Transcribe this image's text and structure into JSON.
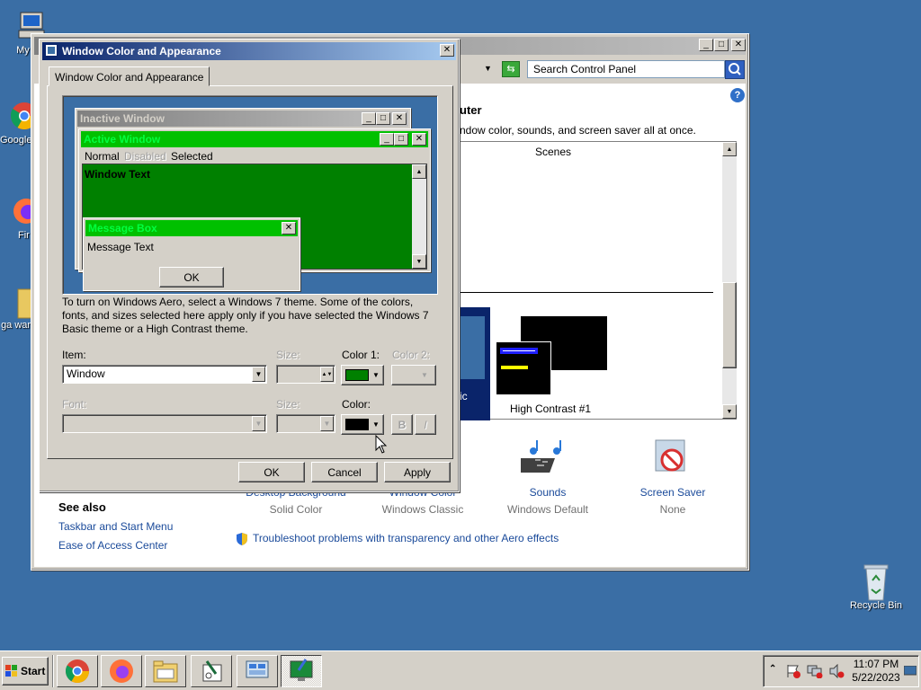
{
  "desktop": {
    "icons": [
      {
        "label": "My Co"
      },
      {
        "label": "Google"
      },
      {
        "label": "Fir"
      },
      {
        "label": "ga warfar"
      },
      {
        "label": "Recycle Bin"
      }
    ]
  },
  "control_panel": {
    "search_placeholder": "Search Control Panel",
    "heading_fragment": "uter",
    "desc_fragment": "ndow color, sounds, and screen saver all at once.",
    "scenes_label": "Scenes",
    "theme_basic_fragment": "ic",
    "theme_hc_label": "High Contrast #1",
    "items": [
      {
        "title": "Desktop Background",
        "value": "Solid Color"
      },
      {
        "title": "Window Color",
        "value": "Windows Classic"
      },
      {
        "title": "Sounds",
        "value": "Windows Default"
      },
      {
        "title": "Screen Saver",
        "value": "None"
      }
    ],
    "see_also": {
      "title": "See also",
      "links": [
        "Taskbar and Start Menu",
        "Ease of Access Center"
      ]
    },
    "troubleshoot": "Troubleshoot problems with transparency and other Aero effects"
  },
  "dialog": {
    "title": "Window Color and Appearance",
    "tab_label": "Window Color and Appearance",
    "preview": {
      "inactive_title": "Inactive Window",
      "active_title": "Active Window",
      "menu_normal": "Normal",
      "menu_disabled": "Disabled",
      "menu_selected": "Selected",
      "window_text": "Window Text",
      "msgbox_title": "Message Box",
      "msgbox_text": "Message Text",
      "msgbox_ok": "OK"
    },
    "info_text": "To turn on Windows Aero, select a Windows 7 theme.  Some of the colors, fonts, and sizes selected here apply only if you have selected the Windows 7 Basic theme or a High Contrast theme.",
    "item_label": "Item:",
    "item_value": "Window",
    "size_label": "Size:",
    "color1_label": "Color 1:",
    "color2_label": "Color 2:",
    "font_label": "Font:",
    "font_size_label": "Size:",
    "color_label": "Color:",
    "bold_label": "B",
    "italic_label": "I",
    "buttons": {
      "ok": "OK",
      "cancel": "Cancel",
      "apply": "Apply"
    },
    "colors": {
      "color1": "#008000",
      "font_color": "#000000",
      "preview_bg": "#008000",
      "active_title": "#00c000"
    }
  },
  "taskbar": {
    "start_label": "Start",
    "time": "11:07 PM",
    "date": "5/22/2023"
  }
}
